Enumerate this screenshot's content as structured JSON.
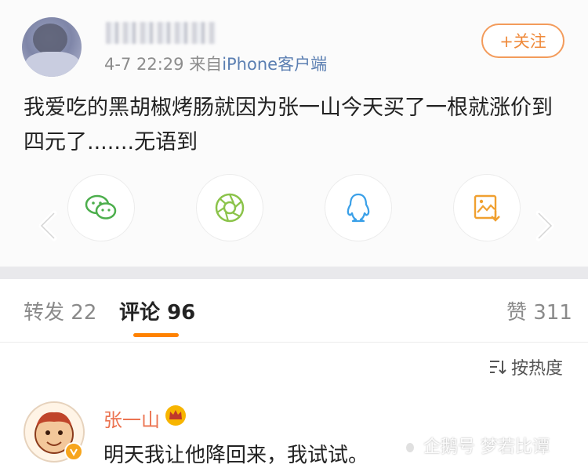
{
  "post": {
    "timestamp": "4-7 22:29",
    "source_prefix": "来自",
    "source_app": "iPhone客户端",
    "follow_label": "+关注",
    "content": "我爱吃的黑胡椒烤肠就因为张一山今天买了一根就涨价到四元了.......无语到"
  },
  "share_icons": [
    "wechat-icon",
    "moments-icon",
    "qq-icon",
    "save-image-icon"
  ],
  "tabs": {
    "repost_label": "转发",
    "repost_count": "22",
    "comment_label": "评论",
    "comment_count": "96",
    "like_label": "赞",
    "like_count": "311"
  },
  "sort_label": "按热度",
  "comment": {
    "author": "张一山",
    "text": "明天我让他降回来，我试试。"
  },
  "watermark": "企鹅号 梦若比谭",
  "colors": {
    "accent": "#ff8200",
    "follow": "#ef8a3b",
    "author": "#eb7350",
    "link": "#5b7fb2"
  }
}
